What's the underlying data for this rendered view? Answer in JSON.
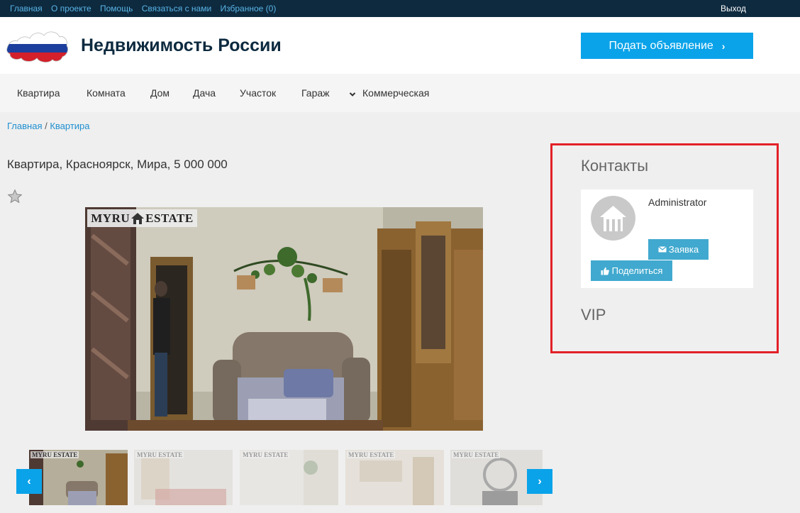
{
  "topbar": {
    "links": [
      "Главная",
      "О проекте",
      "Помощь",
      "Связаться с нами",
      "Избранное (0)"
    ],
    "logout": "Выход"
  },
  "header": {
    "title": "Недвижимость России",
    "post_button": "Подать объявление",
    "logo_icon": "russia-flag-map-icon"
  },
  "nav": {
    "items": [
      "Квартира",
      "Комната",
      "Дом",
      "Дача",
      "Участок",
      "Гараж",
      "Коммерческая"
    ]
  },
  "breadcrumb": {
    "home": "Главная",
    "separator": " / ",
    "current": "Квартира"
  },
  "listing": {
    "title": "Квартира, Красноярск, Мира, 5 000 000",
    "watermark": {
      "left": "MYRU",
      "right": "ESTATE"
    },
    "thumb_watermark": "MYRU ESTATE",
    "thumb_count": 5
  },
  "sidebar": {
    "contacts_title": "Контакты",
    "contact_name": "Administrator",
    "request_button": "Заявка",
    "share_button": "Поделиться",
    "vip_title": "VIP"
  },
  "colors": {
    "accent": "#0aa3e9",
    "topbar": "#0d2a3f",
    "button": "#41a9cf",
    "highlight_border": "#e32027"
  }
}
